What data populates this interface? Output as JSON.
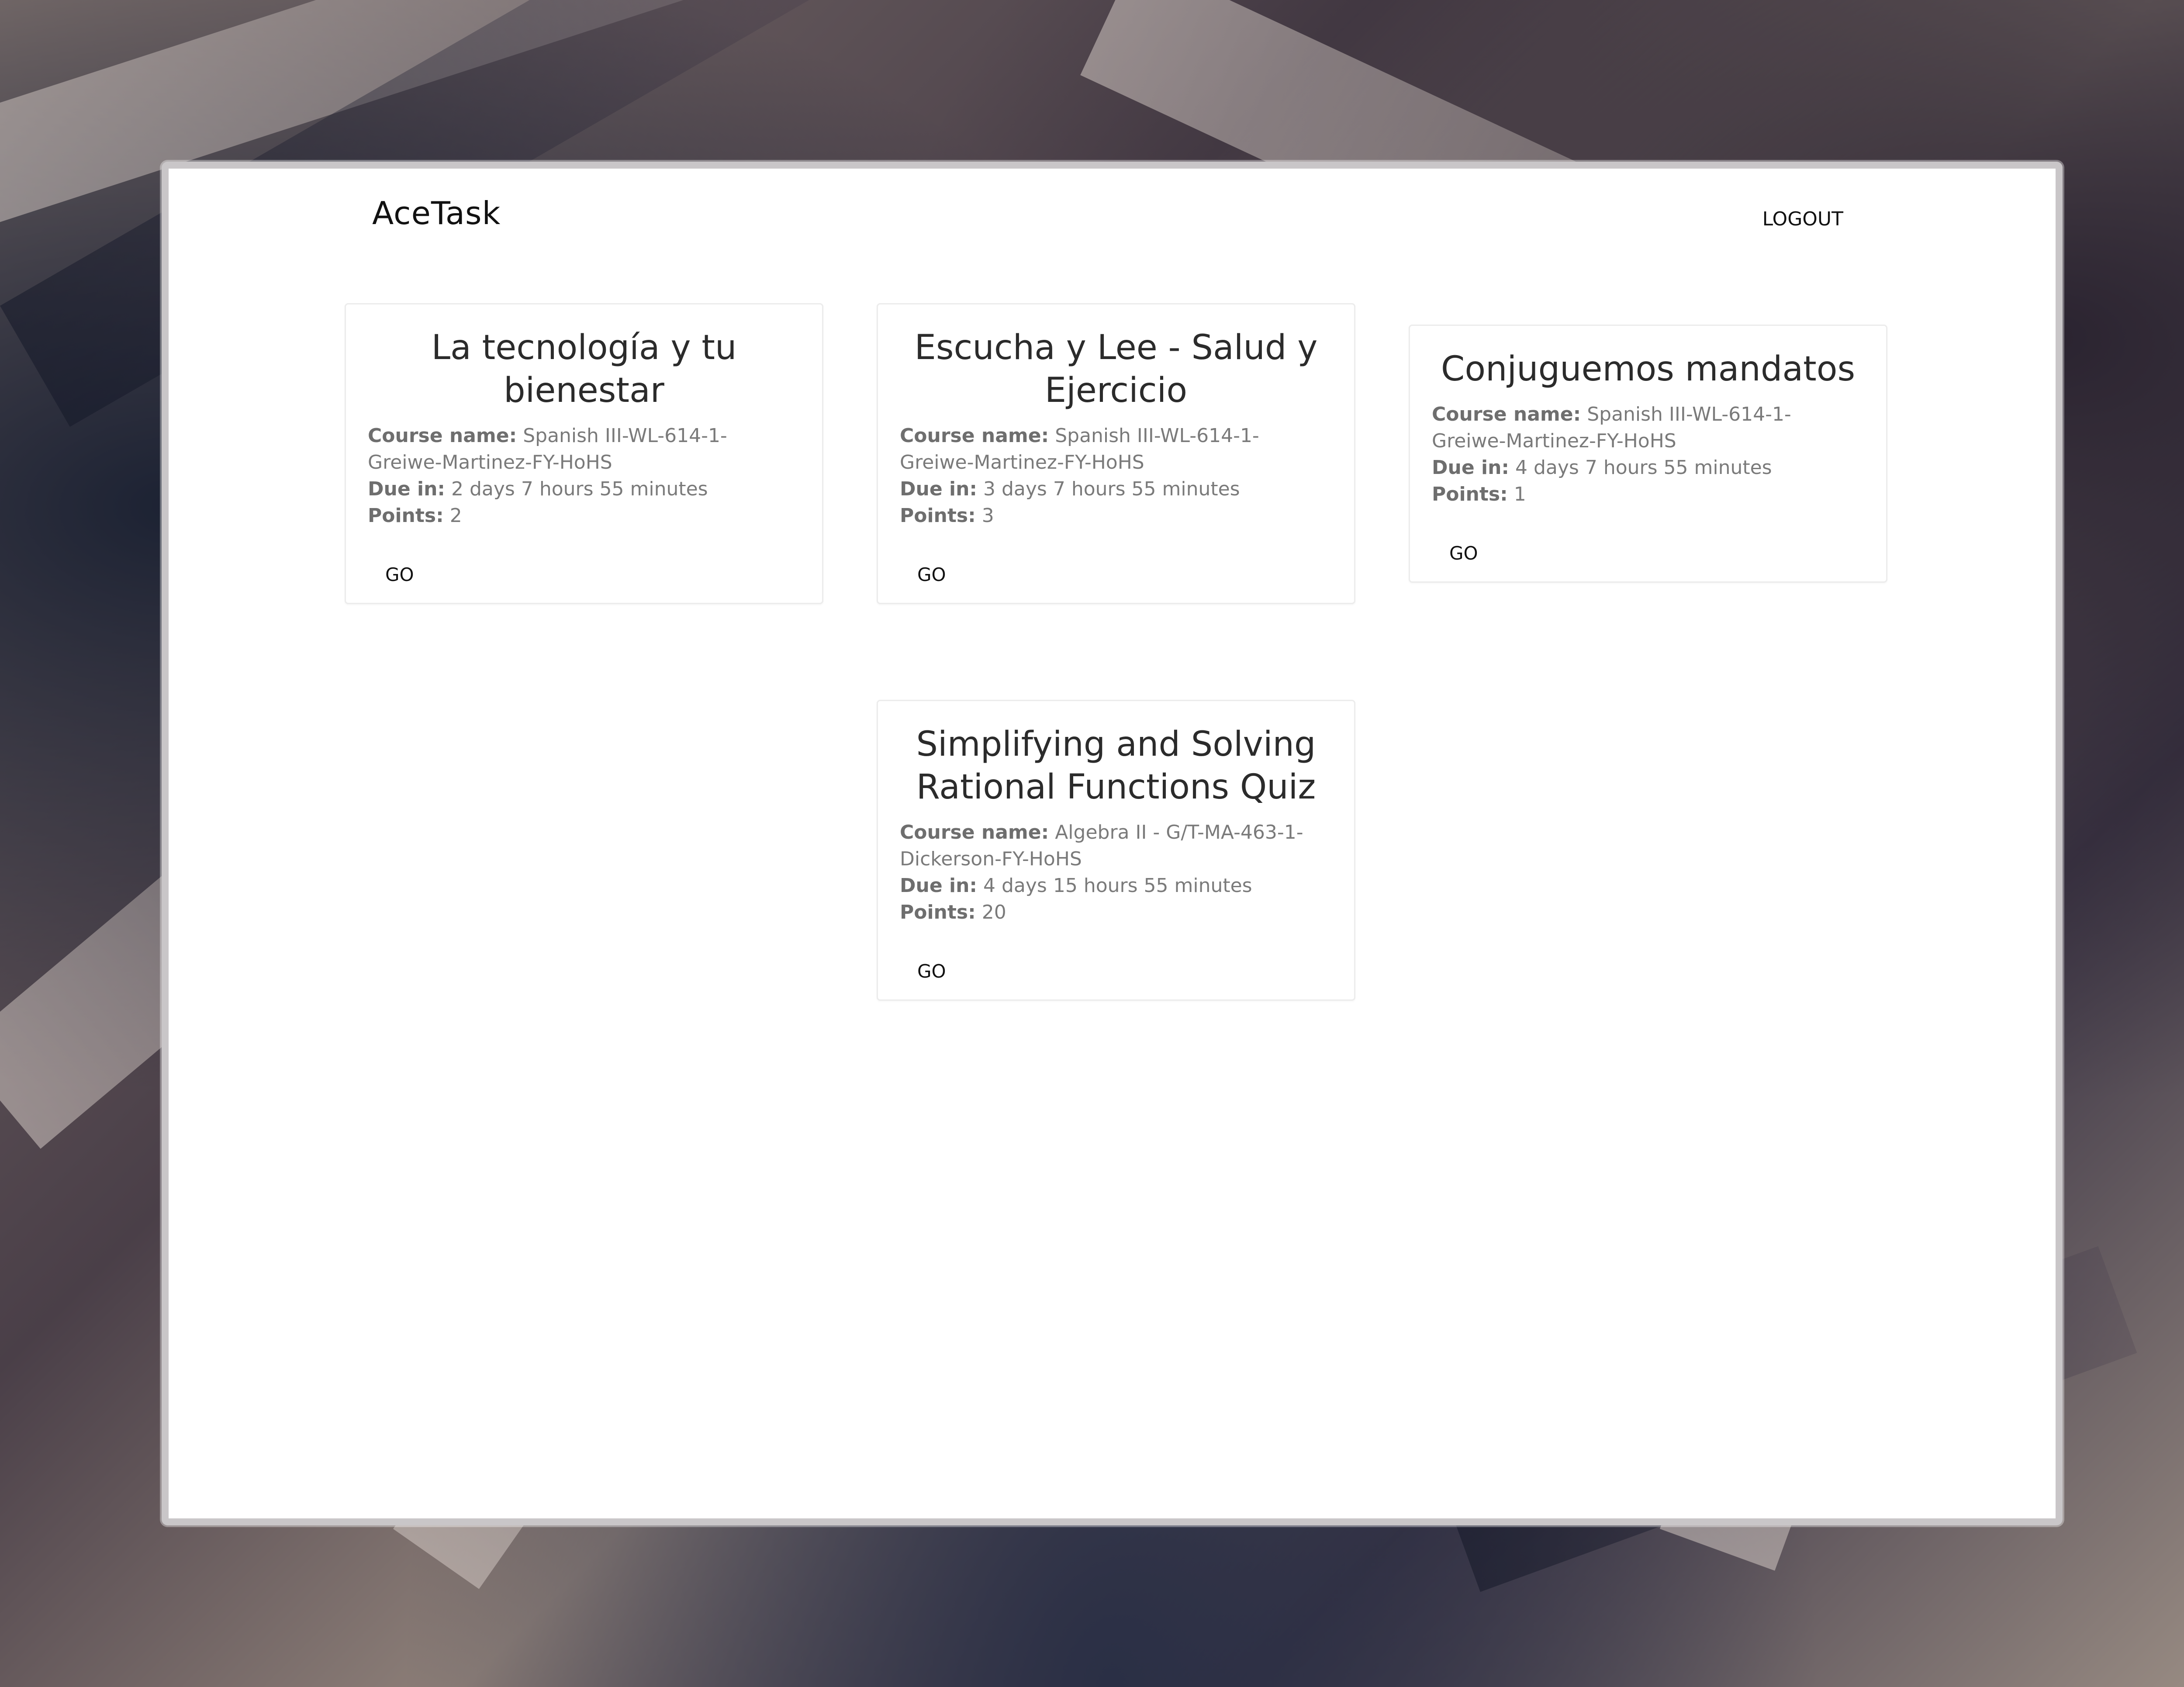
{
  "app": {
    "brand": "AceTask",
    "logout_label": "LOGOUT"
  },
  "labels": {
    "course_name": "Course name:",
    "due_in": "Due in:",
    "points": "Points:",
    "go": "GO"
  },
  "assignments": [
    {
      "title": "La tecnología y tu bienestar",
      "course_name": "Spanish III-WL-614-1-Greiwe-Martinez-FY-HoHS",
      "due_in": "2 days 7 hours 55 minutes",
      "points": "2"
    },
    {
      "title": "Escucha y Lee - Salud y Ejercicio",
      "course_name": "Spanish III-WL-614-1-Greiwe-Martinez-FY-HoHS",
      "due_in": "3 days 7 hours 55 minutes",
      "points": "3"
    },
    {
      "title": "Conjuguemos mandatos",
      "course_name": "Spanish III-WL-614-1-Greiwe-Martinez-FY-HoHS",
      "due_in": "4 days 7 hours 55 minutes",
      "points": "1"
    },
    {
      "title": "Simplifying and Solving Rational Functions Quiz",
      "course_name": "Algebra II - G/T-MA-463-1-Dickerson-FY-HoHS",
      "due_in": "4 days 15 hours 55 minutes",
      "points": "20"
    }
  ]
}
